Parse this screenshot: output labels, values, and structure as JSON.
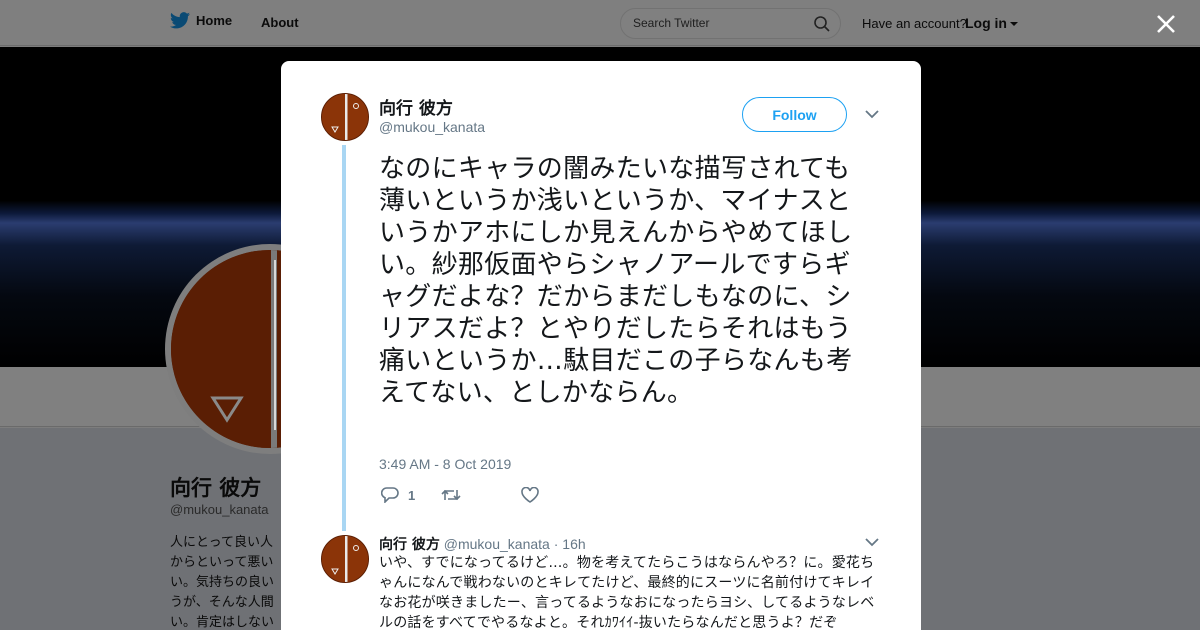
{
  "nav": {
    "home_label": "Home",
    "about_label": "About",
    "search_placeholder": "Search Twitter",
    "have_account": "Have an account?",
    "login_label": "Log in"
  },
  "profile": {
    "name": "向行 彼方",
    "handle": "@mukou_kanata",
    "bio_partial": "人にとって良い人からといって悪いい。気持ちの良いうが、そんな人間い。肯定はしない"
  },
  "tweet": {
    "author_name": "向行 彼方",
    "author_handle": "@mukou_kanata",
    "follow_label": "Follow",
    "text": "なのにキャラの闇みたいな描写されても薄いというか浅いというか、マイナスというかアホにしか見えんからやめてほしい。紗那仮面やらシャノアールですらギャグだよな？だからまだしもなのに、シリアスだよ？とやりだしたらそれはもう痛いというか…駄目だこの子らなんも考えてない、としかならん。",
    "timestamp": "3:49 AM - 8 Oct 2019",
    "reply_count": "1"
  },
  "reply": {
    "author_name": "向行 彼方",
    "author_handle": "@mukou_kanata",
    "separator": " · ",
    "age": "16h",
    "text": "いや、すでになってるけど…。物を考えてたらこうはならんやろ？に。愛花ちゃんになんで戦わないのとキレてたけど、最終的にスーツに名前付けてキレイなお花が咲きましたー、言ってるようなおになったらヨシ、してるようなレベルの話をすべてでやるなよと。それｶﾜｲｲ-抜いたらなんだと思うよ？だぞ"
  },
  "colors": {
    "twitter_blue": "#1da1f2",
    "thread_line": "#a9d6f3",
    "avatar_bg": "#8b3408"
  }
}
